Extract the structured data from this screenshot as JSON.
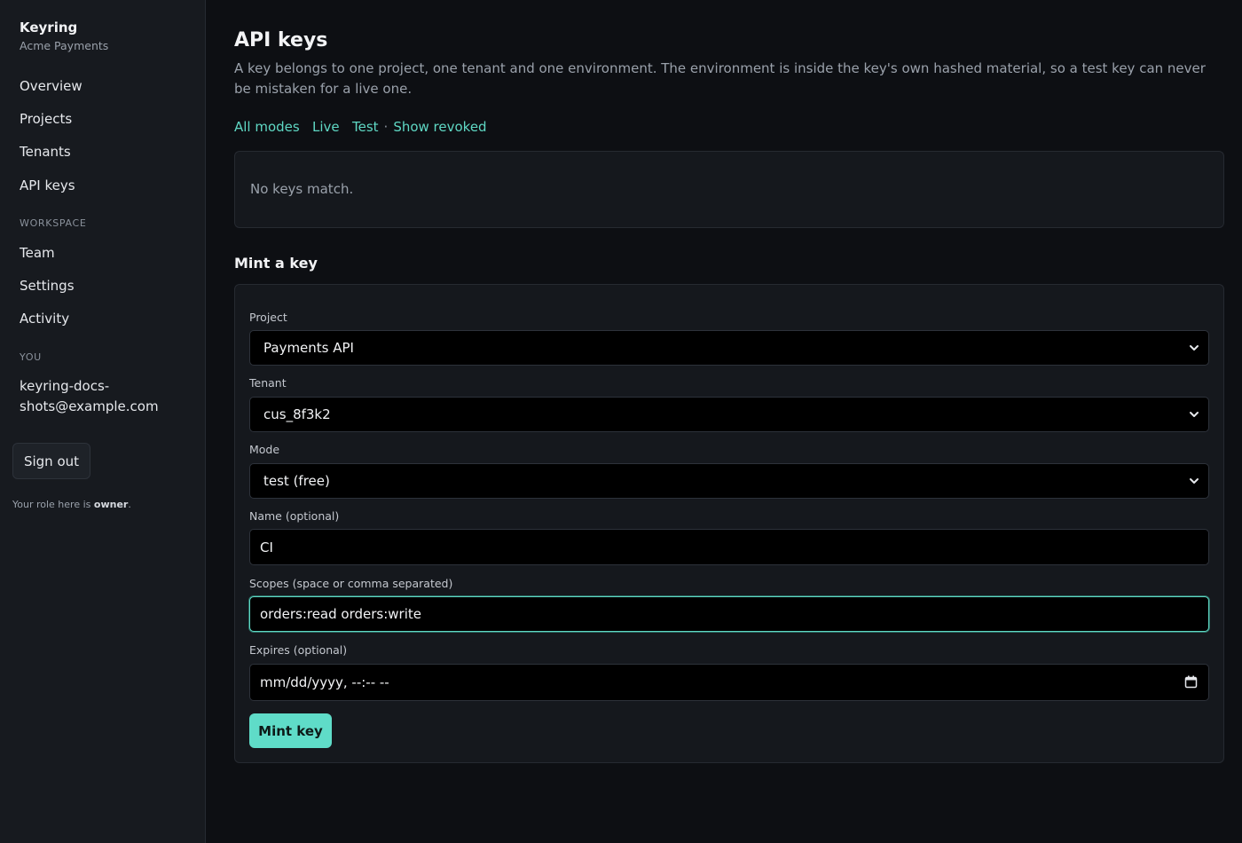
{
  "sidebar": {
    "brand": "Keyring",
    "org": "Acme Payments",
    "items": [
      "Overview",
      "Projects",
      "Tenants",
      "API keys"
    ],
    "workspace_header": "WORKSPACE",
    "workspace_items": [
      "Team",
      "Settings",
      "Activity"
    ],
    "you_header": "YOU",
    "email": "keyring-docs-shots@example.com",
    "sign_out": "Sign out",
    "role_prefix": "Your role here is ",
    "role": "owner",
    "role_suffix": "."
  },
  "main": {
    "title": "API keys",
    "description": "A key belongs to one project, one tenant and one environment. The environment is inside the key's own hashed material, so a test key can never be mistaken for a live one.",
    "filters": [
      "All modes",
      "Live",
      "Test"
    ],
    "filter_separator": "·",
    "show_revoked": "Show revoked",
    "empty_message": "No keys match.",
    "mint_section_title": "Mint a key",
    "form": {
      "project_label": "Project",
      "project_value": "Payments API",
      "tenant_label": "Tenant",
      "tenant_value": "cus_8f3k2",
      "mode_label": "Mode",
      "mode_value": "test (free)",
      "name_label": "Name (optional)",
      "name_value": "CI",
      "scopes_label": "Scopes (space or comma separated)",
      "scopes_value": "orders:read orders:write",
      "expires_label": "Expires (optional)",
      "expires_placeholder": "mm/dd/yyyy, --:-- --",
      "submit": "Mint key"
    }
  },
  "colors": {
    "accent": "#5fdcc8",
    "background": "#0d0f13",
    "sidebar": "#171a1f"
  }
}
